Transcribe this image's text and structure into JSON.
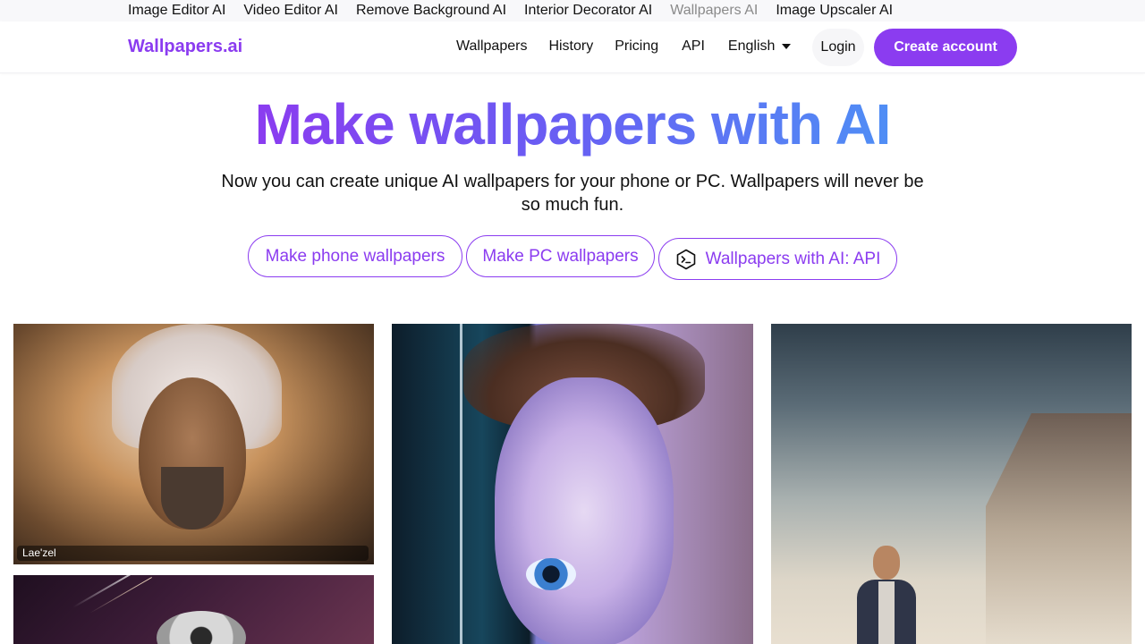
{
  "topbar": {
    "links": [
      {
        "label": "Image Editor AI"
      },
      {
        "label": "Video Editor AI"
      },
      {
        "label": "Remove Background AI"
      },
      {
        "label": "Interior Decorator AI"
      },
      {
        "label": "Wallpapers AI",
        "active": true
      },
      {
        "label": "Image Upscaler AI"
      }
    ]
  },
  "navbar": {
    "brand": "Wallpapers.ai",
    "links": {
      "wallpapers": "Wallpapers",
      "history": "History",
      "pricing": "Pricing",
      "api": "API",
      "language": "English"
    },
    "login": "Login",
    "create_account": "Create account",
    "accent_color": "#8b3cf0"
  },
  "hero": {
    "title": "Make wallpapers with AI",
    "subtitle": "Now you can create unique AI wallpapers for your phone or PC. Wallpapers will never be so much fun.",
    "buttons": {
      "phone": "Make phone wallpapers",
      "pc": "Make PC wallpapers",
      "api": "Wallpapers with AI: API"
    },
    "api_icon": "terminal-hexagon-icon"
  },
  "gallery": {
    "items": [
      {
        "caption": "Lae'zel"
      }
    ]
  }
}
